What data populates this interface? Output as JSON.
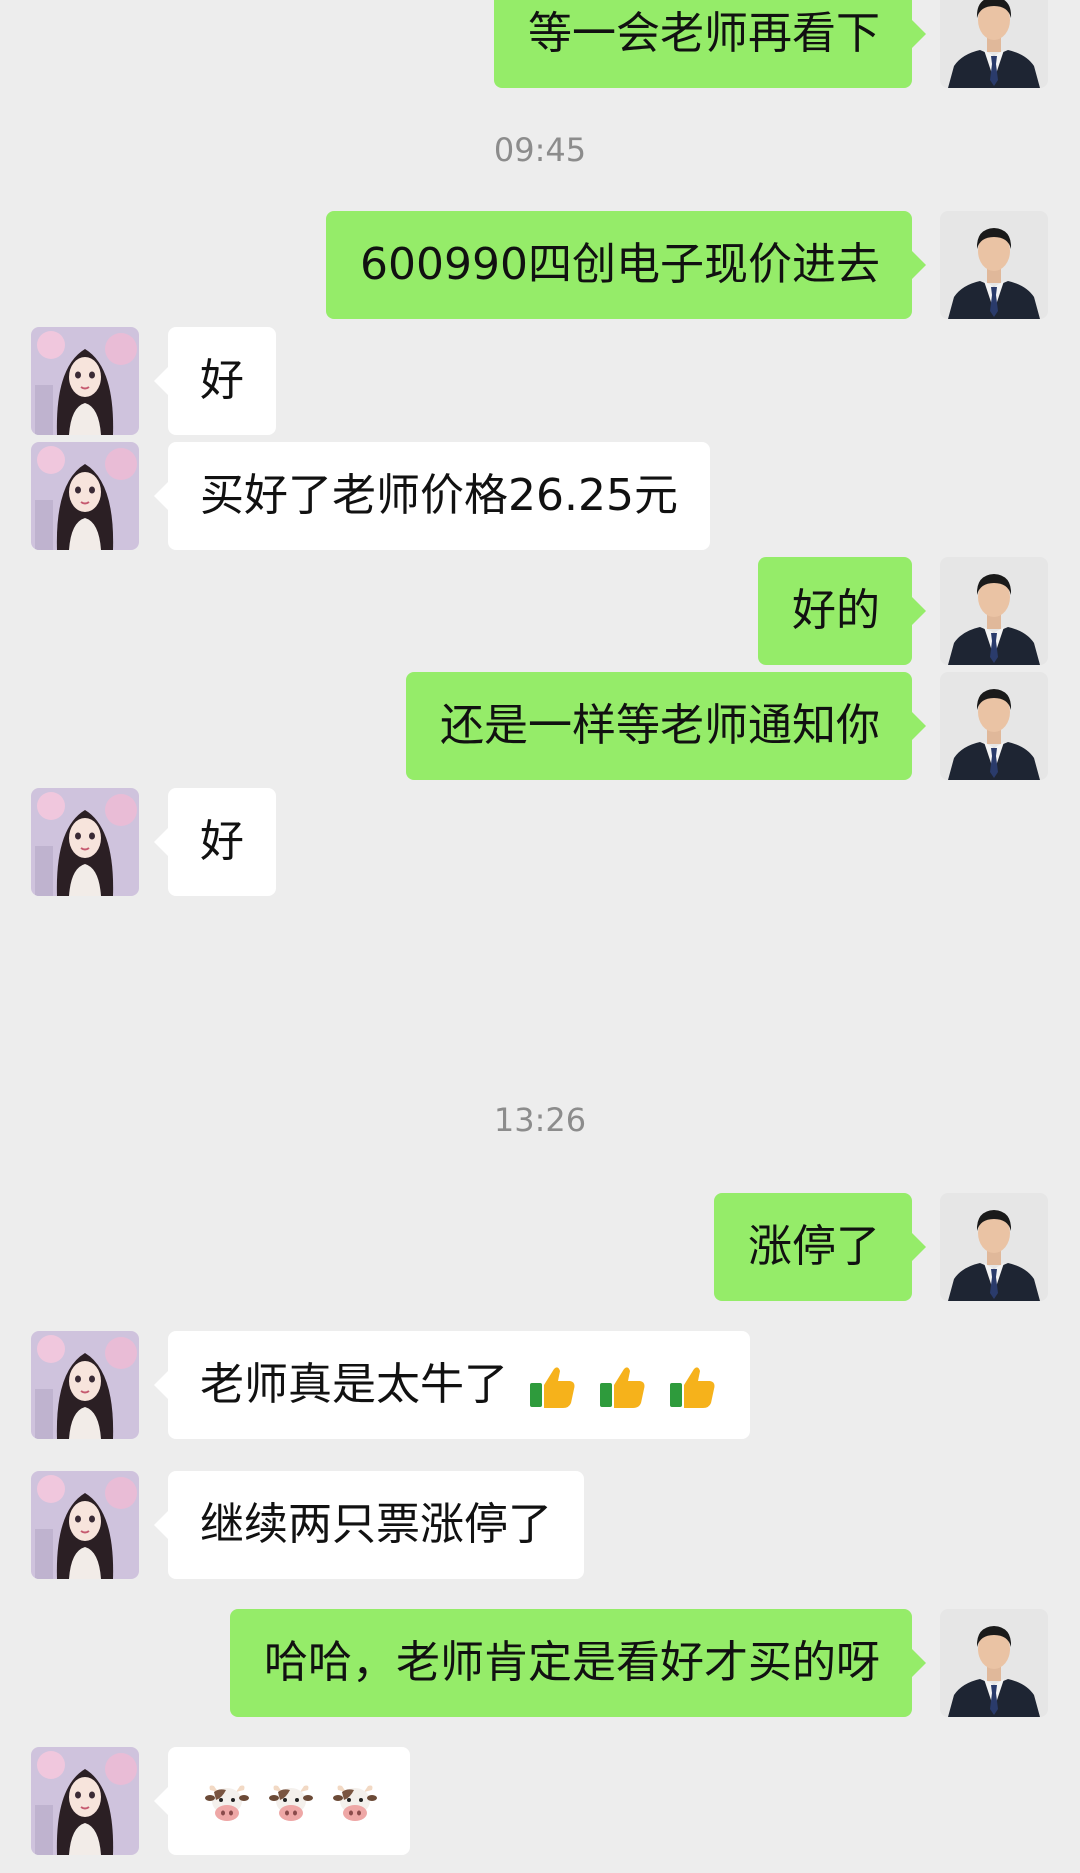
{
  "messages": [
    {
      "type": "sent",
      "text": "等一会老师再看下"
    },
    {
      "type": "time",
      "text": "09:45"
    },
    {
      "type": "sent",
      "text": "600990四创电子现价进去"
    },
    {
      "type": "recv",
      "text": "好"
    },
    {
      "type": "recv",
      "text": "买好了老师价格26.25元"
    },
    {
      "type": "sent",
      "text": "好的"
    },
    {
      "type": "sent",
      "text": "还是一样等老师通知你"
    },
    {
      "type": "recv",
      "text": "好"
    },
    {
      "type": "time",
      "text": "13:26"
    },
    {
      "type": "sent",
      "text": "涨停了"
    },
    {
      "type": "recv",
      "text": "老师真是太牛了",
      "emoji": [
        "thumbs-up-icon",
        "thumbs-up-icon",
        "thumbs-up-icon"
      ]
    },
    {
      "type": "recv",
      "text": "继续两只票涨停了"
    },
    {
      "type": "sent",
      "text": "哈哈，老师肯定是看好才买的呀"
    },
    {
      "type": "recv",
      "text": "",
      "emoji": [
        "cow-face-icon",
        "cow-face-icon",
        "cow-face-icon"
      ]
    }
  ],
  "colors": {
    "background": "#ededed",
    "sent_bubble": "#95ec69",
    "received_bubble": "#ffffff",
    "timestamp_text": "#8c8c8c"
  }
}
